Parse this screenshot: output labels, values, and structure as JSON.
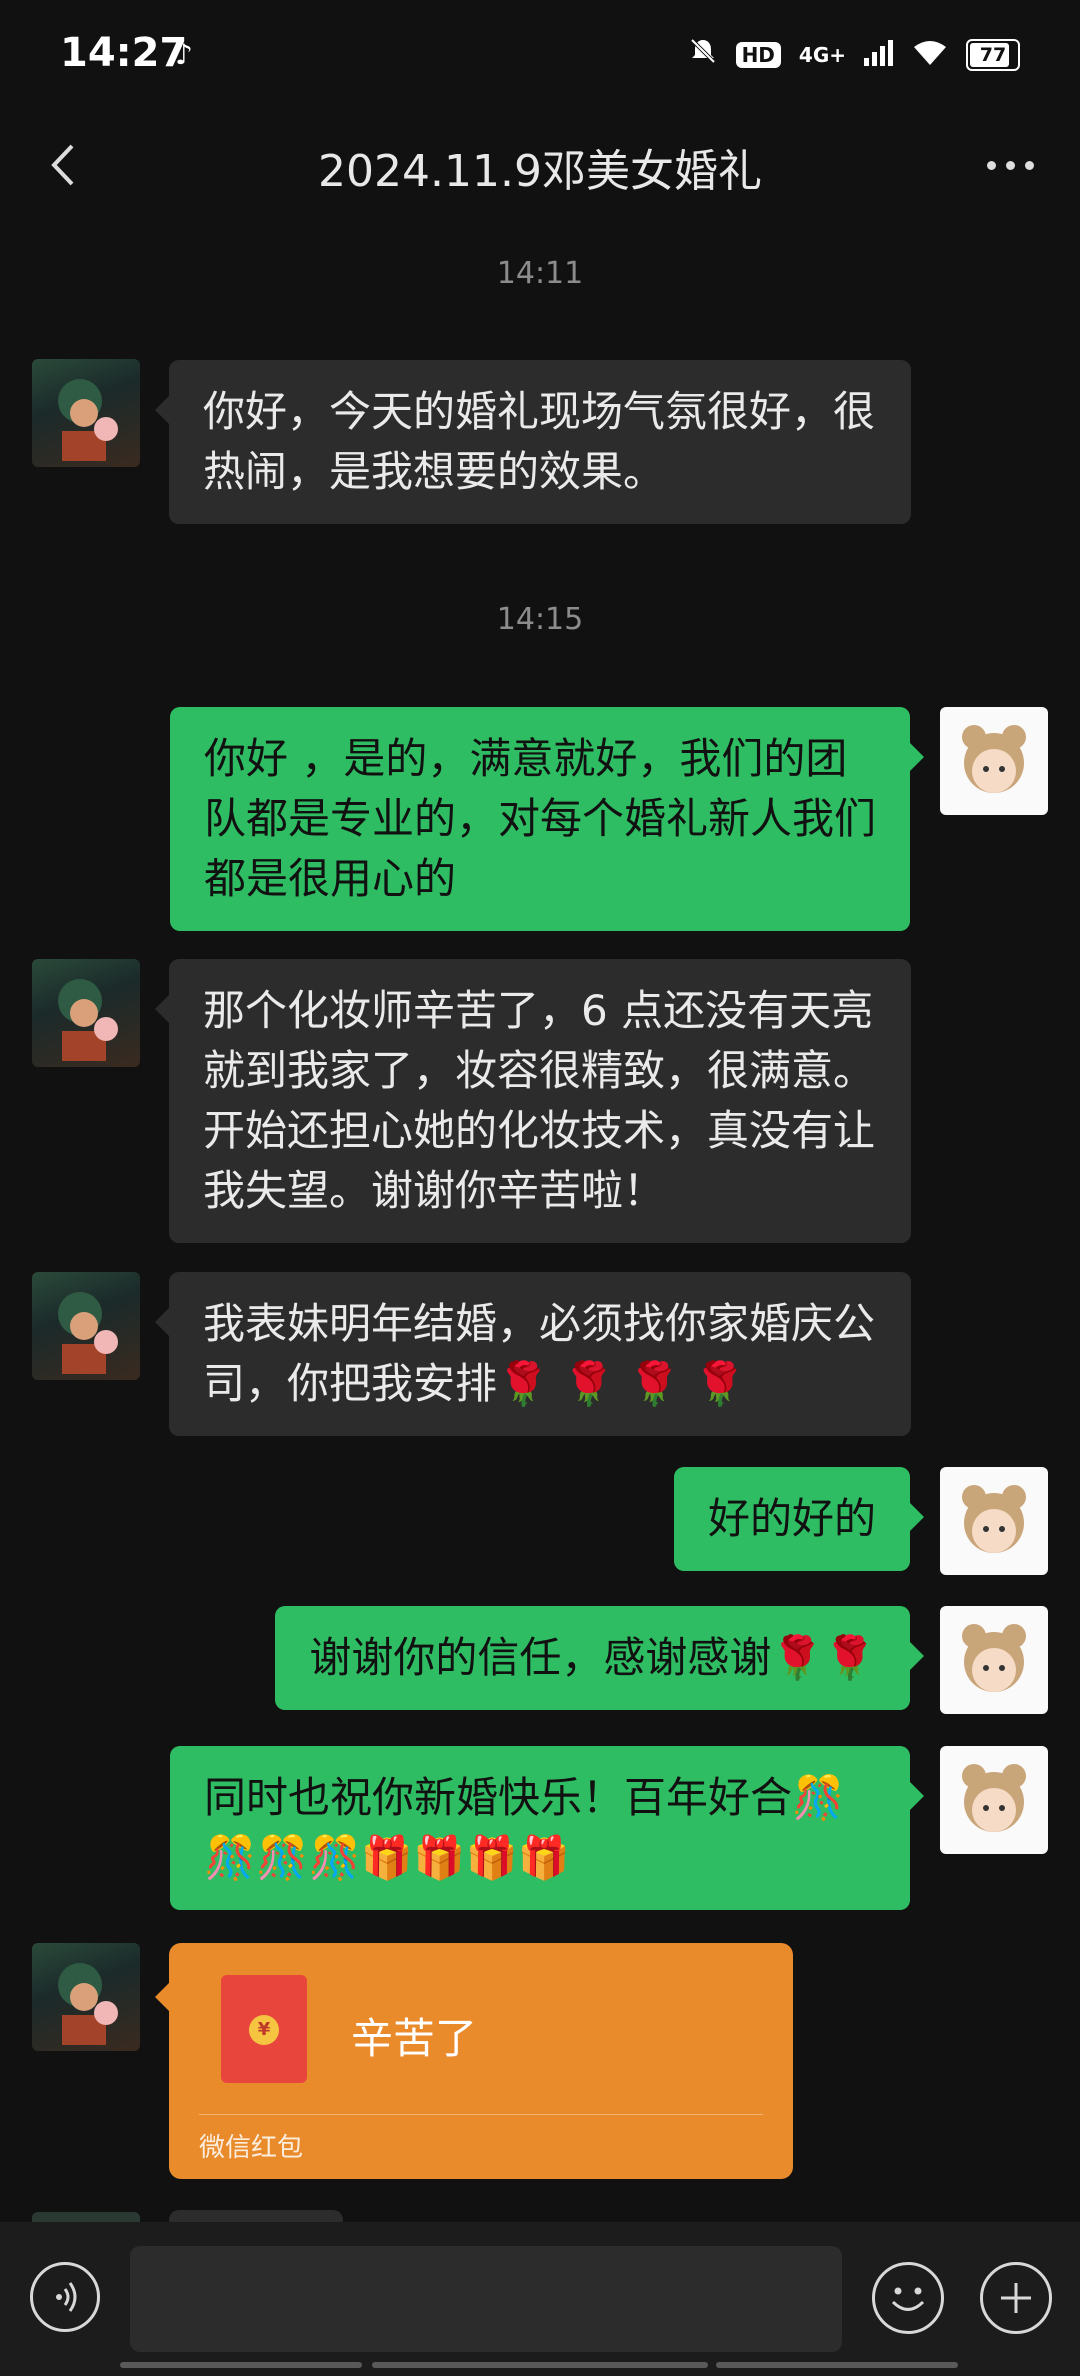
{
  "status_bar": {
    "time": "14:27",
    "network": "4G+",
    "hd": "HD",
    "battery": "77",
    "battery_level": 0.77,
    "icons": [
      "tiktok-icon",
      "mute-bell-icon",
      "hd-icon",
      "signal-icon",
      "wifi-icon",
      "battery-icon"
    ]
  },
  "header": {
    "title": "2024.11.9邓美女婚礼",
    "icons": [
      "back-arrow-icon",
      "more-icon"
    ]
  },
  "messages": [
    {
      "type": "time",
      "text": "14:11"
    },
    {
      "type": "text",
      "side": "left",
      "text": "你好，今天的婚礼现场气氛很好，很热闹，是我想要的效果。"
    },
    {
      "type": "time",
      "text": "14:15"
    },
    {
      "type": "text",
      "side": "right",
      "text": "你好 ，是的，满意就好，我们的团队都是专业的，对每个婚礼新人我们都是很用心的"
    },
    {
      "type": "text",
      "side": "left",
      "text": "那个化妆师辛苦了，6 点还没有天亮就到我家了，妆容很精致，很满意。开始还担心她的化妆技术，真没有让我失望。谢谢你辛苦啦！"
    },
    {
      "type": "text",
      "side": "left",
      "text": "我表妹明年结婚，必须找你家婚庆公司，你把我安排🌹 🌹 🌹 🌹"
    },
    {
      "type": "text",
      "side": "right",
      "text": "好的好的"
    },
    {
      "type": "text",
      "side": "right",
      "text": "谢谢你的信任，感谢感谢🌹🌹"
    },
    {
      "type": "text",
      "side": "right",
      "text": "同时也祝你新婚快乐！百年好合🎊🎊🎊🎊🎁🎁🎁🎁"
    },
    {
      "type": "red_packet",
      "side": "left",
      "title": "辛苦了",
      "label": "微信红包",
      "coin": "¥"
    }
  ],
  "input_bar": {
    "value": "",
    "icons": [
      "voice-icon",
      "emoji-icon",
      "plus-icon"
    ]
  },
  "colors": {
    "background": "#111111",
    "bubble_self": "#2fbd63",
    "bubble_other": "#2c2c2c",
    "red_packet": "#e98a2b"
  }
}
